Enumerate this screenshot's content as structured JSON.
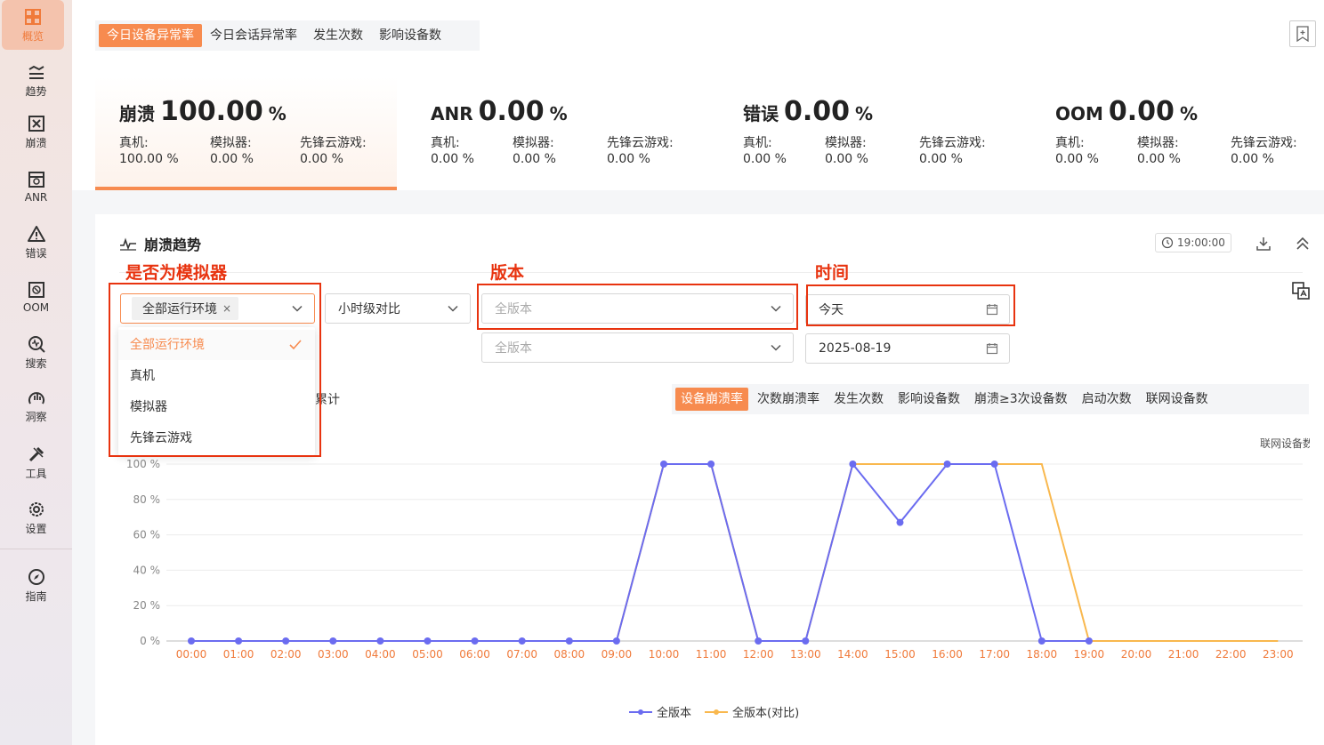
{
  "sidebar": {
    "items": [
      {
        "label": "概览",
        "icon": "dashboard-icon",
        "active": true
      },
      {
        "label": "趋势",
        "icon": "trend-icon"
      },
      {
        "label": "崩溃",
        "icon": "crash-icon"
      },
      {
        "label": "ANR",
        "icon": "anr-icon"
      },
      {
        "label": "错误",
        "icon": "warning-icon"
      },
      {
        "label": "OOM",
        "icon": "oom-icon"
      },
      {
        "label": "搜索",
        "icon": "search-icon"
      },
      {
        "label": "洞察",
        "icon": "insight-icon"
      },
      {
        "label": "工具",
        "icon": "tools-icon"
      },
      {
        "label": "设置",
        "icon": "gear-icon"
      },
      {
        "label": "指南",
        "icon": "compass-icon"
      }
    ]
  },
  "top_tabs": [
    {
      "label": "今日设备异常率",
      "active": true
    },
    {
      "label": "今日会话异常率"
    },
    {
      "label": "发生次数"
    },
    {
      "label": "影响设备数"
    }
  ],
  "metrics": [
    {
      "name": "崩溃",
      "value": "100.00",
      "unit": "%",
      "subs": [
        {
          "label": "真机:",
          "value": "100.00 %"
        },
        {
          "label": "模拟器:",
          "value": "0.00 %"
        },
        {
          "label": "先锋云游戏:",
          "value": "0.00 %"
        }
      ]
    },
    {
      "name": "ANR",
      "value": "0.00",
      "unit": "%",
      "subs": [
        {
          "label": "真机:",
          "value": "0.00 %"
        },
        {
          "label": "模拟器:",
          "value": "0.00 %"
        },
        {
          "label": "先锋云游戏:",
          "value": "0.00 %"
        }
      ]
    },
    {
      "name": "错误",
      "value": "0.00",
      "unit": "%",
      "subs": [
        {
          "label": "真机:",
          "value": "0.00 %"
        },
        {
          "label": "模拟器:",
          "value": "0.00 %"
        },
        {
          "label": "先锋云游戏:",
          "value": "0.00 %"
        }
      ]
    },
    {
      "name": "OOM",
      "value": "0.00",
      "unit": "%",
      "subs": [
        {
          "label": "真机:",
          "value": "0.00 %"
        },
        {
          "label": "模拟器:",
          "value": "0.00 %"
        },
        {
          "label": "先锋云游戏:",
          "value": "0.00 %"
        }
      ]
    }
  ],
  "panel": {
    "title": "崩溃趋势",
    "time_badge": "19:00:00",
    "annotations": {
      "env": "是否为模拟器",
      "version": "版本",
      "time": "时间"
    },
    "env_chip": "全部运行环境",
    "env_chip_close": "×",
    "compare_select": "小时级对比",
    "version_placeholder_1": "全版本",
    "version_placeholder_2": "全版本",
    "date_1": "今天",
    "date_2": "2025-08-19",
    "dropdown_options": [
      {
        "label": "全部运行环境",
        "selected": true
      },
      {
        "label": "真机"
      },
      {
        "label": "模拟器"
      },
      {
        "label": "先锋云游戏"
      }
    ],
    "cumulative_label": "累计",
    "metric_tabs": [
      {
        "label": "设备崩溃率",
        "active": true
      },
      {
        "label": "次数崩溃率"
      },
      {
        "label": "发生次数"
      },
      {
        "label": "影响设备数"
      },
      {
        "label": "崩溃≥3次设备数"
      },
      {
        "label": "启动次数"
      },
      {
        "label": "联网设备数"
      }
    ],
    "right_axis_label": "联网设备数"
  },
  "chart_data": {
    "type": "line",
    "categories": [
      "00:00",
      "01:00",
      "02:00",
      "03:00",
      "04:00",
      "05:00",
      "06:00",
      "07:00",
      "08:00",
      "09:00",
      "10:00",
      "11:00",
      "12:00",
      "13:00",
      "14:00",
      "15:00",
      "16:00",
      "17:00",
      "18:00",
      "19:00",
      "20:00",
      "21:00",
      "22:00",
      "23:00"
    ],
    "yticks": [
      "0 %",
      "20 %",
      "40 %",
      "60 %",
      "80 %",
      "100 %"
    ],
    "ylim": [
      0,
      100
    ],
    "series": [
      {
        "name": "全版本",
        "color": "#6b6cf0",
        "values": [
          0,
          0,
          0,
          0,
          0,
          0,
          0,
          0,
          0,
          0,
          100,
          100,
          0,
          0,
          100,
          67,
          100,
          100,
          0,
          0,
          null,
          null,
          null,
          null
        ]
      },
      {
        "name": "全版本(对比)",
        "color": "#f9b84e",
        "values": [
          0,
          0,
          0,
          0,
          0,
          0,
          0,
          0,
          0,
          0,
          100,
          100,
          0,
          0,
          100,
          100,
          100,
          100,
          100,
          0,
          0,
          0,
          0,
          0
        ]
      }
    ],
    "legend_position": "bottom-center"
  },
  "colors": {
    "accent": "#f78b4f",
    "annotation": "#e8330f"
  }
}
